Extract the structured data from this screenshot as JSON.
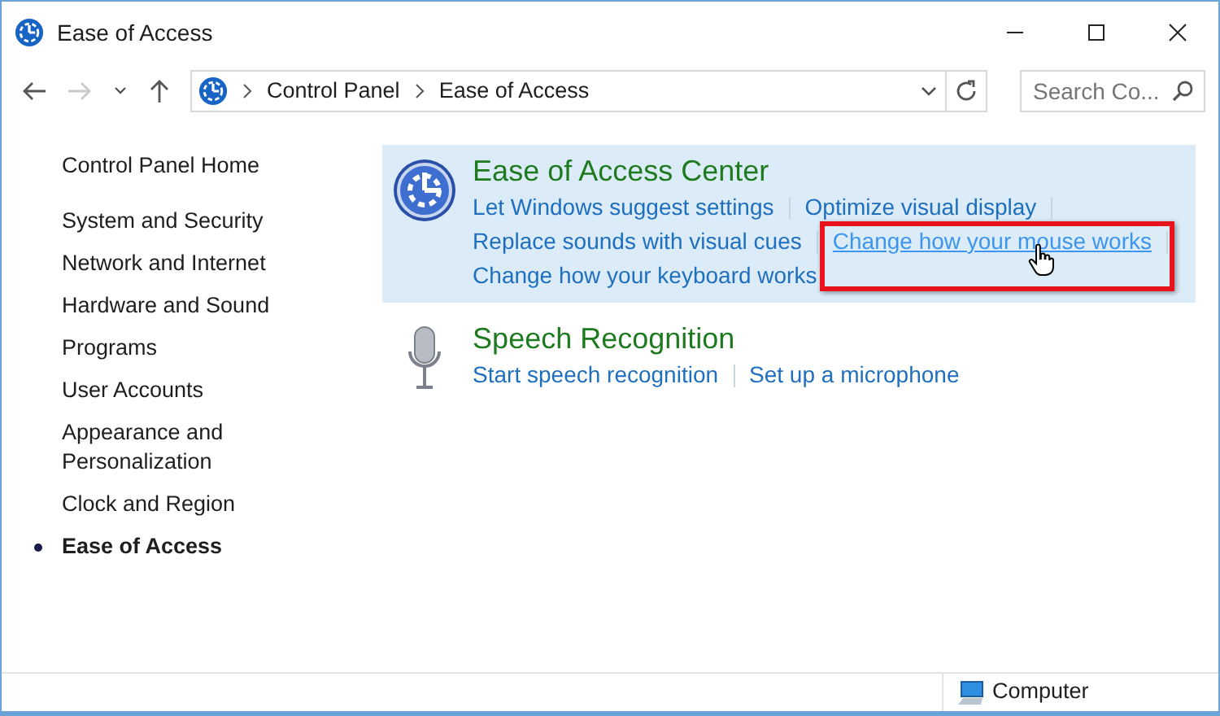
{
  "window": {
    "title": "Ease of Access"
  },
  "nav": {
    "back_enabled": true,
    "forward_enabled": false,
    "breadcrumb": [
      "Control Panel",
      "Ease of Access"
    ],
    "search": {
      "placeholder": "Search Co..."
    }
  },
  "sidebar": {
    "home": "Control Panel Home",
    "items": [
      {
        "label": "System and Security",
        "selected": false
      },
      {
        "label": "Network and Internet",
        "selected": false
      },
      {
        "label": "Hardware and Sound",
        "selected": false
      },
      {
        "label": "Programs",
        "selected": false
      },
      {
        "label": "User Accounts",
        "selected": false
      },
      {
        "label": "Appearance and Personalization",
        "selected": false
      },
      {
        "label": "Clock and Region",
        "selected": false
      },
      {
        "label": "Ease of Access",
        "selected": true
      }
    ]
  },
  "categories": [
    {
      "kind": "ease",
      "title": "Ease of Access Center",
      "highlighted": true,
      "link_rows": [
        [
          {
            "text": "Let Windows suggest settings",
            "hovered": false,
            "annotated": false
          },
          {
            "text": "Optimize visual display",
            "hovered": false,
            "annotated": false
          }
        ],
        [
          {
            "text": "Replace sounds with visual cues",
            "hovered": false,
            "annotated": false
          },
          {
            "text": "Change how your mouse works",
            "hovered": true,
            "annotated": true
          }
        ],
        [
          {
            "text": "Change how your keyboard works",
            "hovered": false,
            "annotated": false
          }
        ]
      ]
    },
    {
      "kind": "speech",
      "title": "Speech Recognition",
      "highlighted": false,
      "link_rows": [
        [
          {
            "text": "Start speech recognition",
            "hovered": false,
            "annotated": false
          },
          {
            "text": "Set up a microphone",
            "hovered": false,
            "annotated": false
          }
        ]
      ]
    }
  ],
  "status_bar": {
    "text": "Computer"
  }
}
